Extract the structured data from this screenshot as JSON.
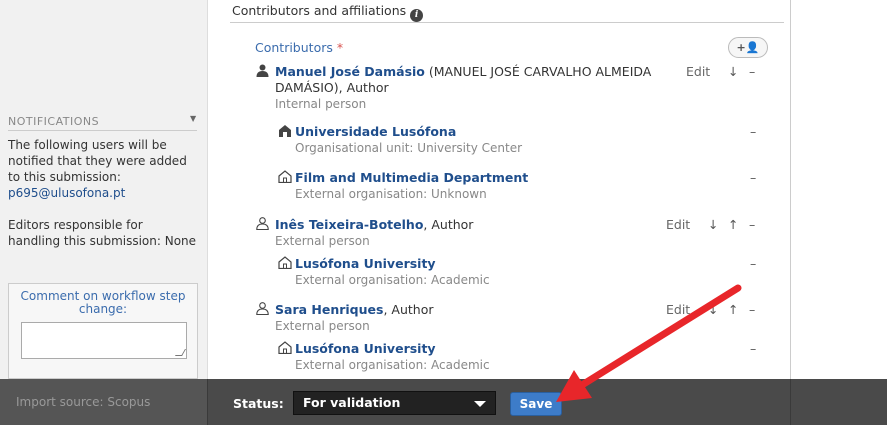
{
  "section": {
    "title": "Contributors and affiliations"
  },
  "contributors": {
    "heading": "Contributors",
    "required_mark": "*",
    "add_label": "+👤",
    "items": [
      {
        "name": "Manuel José Damásio",
        "extra": " (MANUEL JOSÉ CARVALHO ALMEIDA",
        "extra2": "DAMÁSIO), Author",
        "type": "Internal person",
        "icon": "person-solid-icon",
        "edit": "Edit",
        "down": "↓",
        "up": "",
        "remove": "–",
        "orgs": [
          {
            "name": "Universidade Lusófona",
            "type": "Organisational unit: University Center",
            "icon": "building-solid-icon",
            "remove": "–"
          },
          {
            "name": "Film and Multimedia Department",
            "type": "External organisation: Unknown",
            "icon": "building-outline-icon",
            "remove": "–"
          }
        ]
      },
      {
        "name": "Inês Teixeira-Botelho",
        "extra": ", Author",
        "type": "External person",
        "icon": "person-outline-icon",
        "edit": "Edit",
        "down": "↓",
        "up": "↑",
        "remove": "–",
        "orgs": [
          {
            "name": "Lusófona University",
            "type": "External organisation: Academic",
            "icon": "building-outline-icon",
            "remove": "–"
          }
        ]
      },
      {
        "name": "Sara Henriques",
        "extra": ", Author",
        "type": "External person",
        "icon": "person-outline-icon",
        "edit": "Edit",
        "down": "↓",
        "up": "↑",
        "remove": "–",
        "orgs": [
          {
            "name": "Lusófona University",
            "type": "External organisation: Academic",
            "icon": "building-outline-icon",
            "remove": "–"
          }
        ]
      }
    ]
  },
  "notifications": {
    "heading": "NOTIFICATIONS",
    "text1": "The following users will be notified that they were added to this submission:",
    "email": "p695@ulusofona.pt",
    "text2": "Editors responsible for handling this submission: None",
    "comment_label": "Comment on workflow step change:"
  },
  "footer": {
    "import_source": "Import source: Scopus",
    "status_label": "Status:",
    "status_value": "For validation",
    "save_label": "Save"
  },
  "colors": {
    "accent": "#3d7cc9",
    "link": "#1f4e8c",
    "arrow": "#e8262a"
  }
}
